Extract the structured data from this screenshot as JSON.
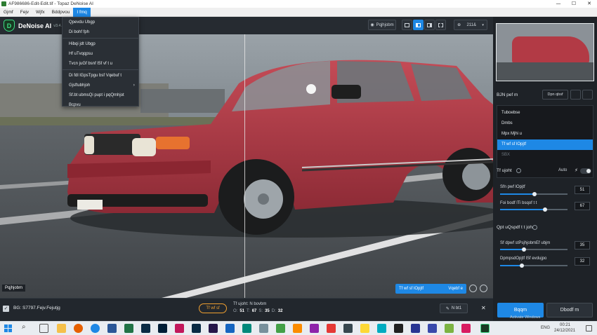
{
  "window": {
    "title": "AF986686-Edit-Edit.tif - Topaz DeNoise AI",
    "min": "—",
    "max": "☐",
    "close": "✕"
  },
  "menubar": {
    "items": [
      "Gjmf",
      "Fejv",
      "Wjfx",
      "Bddpvou",
      "I fmq"
    ]
  },
  "app": {
    "name": "DeNoise AI",
    "version": "v3.4.1"
  },
  "toolbar": {
    "preview_label": "Pqjhjobm",
    "zoom": "211&"
  },
  "help_menu": {
    "items": [
      "Qpevdu Ubgp",
      "Di bohf fph",
      "Hibqi jdt Ubgp",
      "Hf uTvqqpsu",
      "Tvcn juGf bsnf lSf vf t u",
      "Di fdl lGpsTpgu bsf Vqebuf t",
      "Gjsftubhjoh",
      "Sf.bt ubmsQi pupt i pqQmhjot",
      "Bcpvu"
    ]
  },
  "viewer": {
    "original_label": "Pqjhjobm",
    "model_badge": "Tf wf sf lOpjtf",
    "update_badge": "Vqebf e"
  },
  "bottom": {
    "file_info": "BG: S7797.Fejv.Fejutjg",
    "checked": true,
    "model_button": "Tf wf sf",
    "settings_label": "Tf ujoht: N bovbm",
    "o_label": "O:",
    "o_value": "51",
    "t_label": "T:",
    "t_value": "67",
    "s_label": "S:",
    "s_value": "35",
    "d_label": "D:",
    "d_value": "32",
    "edit_button": "N bt1",
    "close": "✕"
  },
  "right_panel": {
    "model_title": "BJN pef m",
    "compare_button": "Dpn qbsf",
    "models": [
      "Tuboebse",
      "Dmbs",
      "Mpx Mjhi u",
      "Tf wf sf lOpjtf",
      "SBX"
    ],
    "selected_model_index": 3,
    "settings_title": "Tf ujoht",
    "auto_label": "Auto",
    "remove_noise_label": "Sfn pwf lOpjtf",
    "remove_noise_value": "51",
    "remove_noise_level": 0.51,
    "enhance_sharpness_label": "Foi bodf lTi bsqof t t",
    "enhance_sharpness_value": "67",
    "enhance_sharpness_level": 0.67,
    "optional_title": "Qpt uQspdf t t joh",
    "recover_detail_label": "Sf dpwf stPsjhjobmEf ubjm",
    "recover_detail_value": "35",
    "recover_detail_level": 0.35,
    "reduce_color_label": "DpmpsdOpjtf lSf evdujpo",
    "reduce_color_value": "32",
    "reduce_color_level": 0.32,
    "apply_button": "Bqqm",
    "cancel_button": "Dbodf m"
  },
  "taskbar": {
    "search_icon": "⌕",
    "lang": "ENG",
    "time": "00:21",
    "date": "24/12/2021",
    "watermark": "Activate Windows"
  },
  "colors": {
    "accent": "#1e88e5",
    "brand_green": "#3ddc84",
    "panel_bg": "#1e2227",
    "car_red": "#b23a45"
  }
}
